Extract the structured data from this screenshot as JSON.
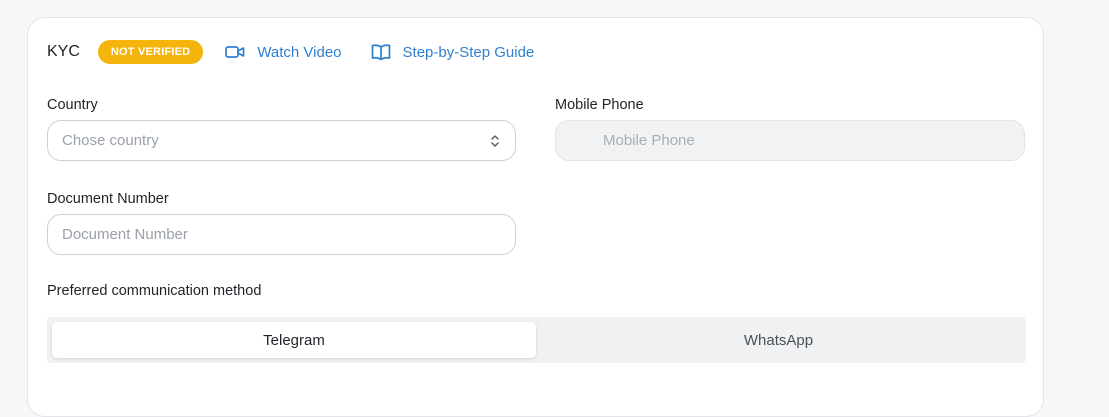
{
  "kyc": {
    "title": "KYC",
    "status_badge": "NOT VERIFIED",
    "watch_video": "Watch Video",
    "guide": "Step-by-Step Guide"
  },
  "form": {
    "country": {
      "label": "Country",
      "placeholder": "Chose country"
    },
    "mobile_phone": {
      "label": "Mobile Phone",
      "placeholder": "Mobile Phone"
    },
    "document_number": {
      "label": "Document Number",
      "placeholder": "Document Number"
    }
  },
  "communication": {
    "label": "Preferred communication method",
    "options": [
      "Telegram",
      "WhatsApp"
    ],
    "selected": "Telegram"
  },
  "colors": {
    "accent": "#2f7fd1",
    "badge": "#f5b40c",
    "border": "#cdd1d6",
    "segment_bg": "#f0f1f3"
  },
  "icons": {
    "watch_video": "video-camera-icon",
    "guide": "open-book-icon",
    "country_select": "chevron-up-down-icon"
  }
}
